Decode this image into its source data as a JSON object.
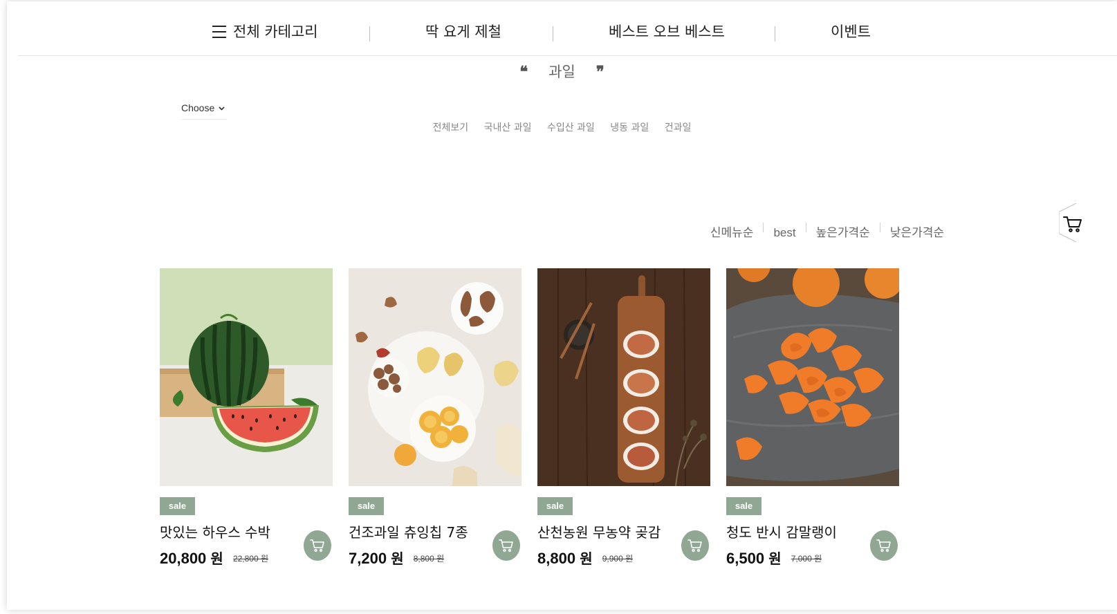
{
  "nav": {
    "all_categories": "전체 카테고리",
    "item2": "딱 요게 제철",
    "item3": "베스트 오브 베스트",
    "item4": "이벤트"
  },
  "category": {
    "title": "과일",
    "open_quote": "❝",
    "close_quote": "❞"
  },
  "choose": {
    "label": "Choose"
  },
  "subcategories": [
    "전체보기",
    "국내산 과일",
    "수입산 과일",
    "냉동 과일",
    "건과일"
  ],
  "sort_options": [
    "신메뉴순",
    "best",
    "높은가격순",
    "낮은가격순"
  ],
  "products": [
    {
      "badge": "sale",
      "name": "맛있는 하우스 수박",
      "price": "20,800",
      "unit": "원",
      "original": "22,800 원",
      "image": "watermelon"
    },
    {
      "badge": "sale",
      "name": "건조과일 츄잉칩 7종",
      "price": "7,200",
      "unit": "원",
      "original": "8,800 원",
      "image": "dried-fruit-chips"
    },
    {
      "badge": "sale",
      "name": "산천농원 무농약 곶감",
      "price": "8,800",
      "unit": "원",
      "original": "9,900 원",
      "image": "dried-persimmon-board"
    },
    {
      "badge": "sale",
      "name": "청도 반시 감말랭이",
      "price": "6,500",
      "unit": "원",
      "original": "7,000 원",
      "image": "dried-persimmon-slices"
    }
  ],
  "colors": {
    "accent": "#8fa793",
    "text": "#222222",
    "muted": "#888888"
  },
  "icons": {
    "menu": "hamburger-icon",
    "cart": "cart-icon"
  }
}
